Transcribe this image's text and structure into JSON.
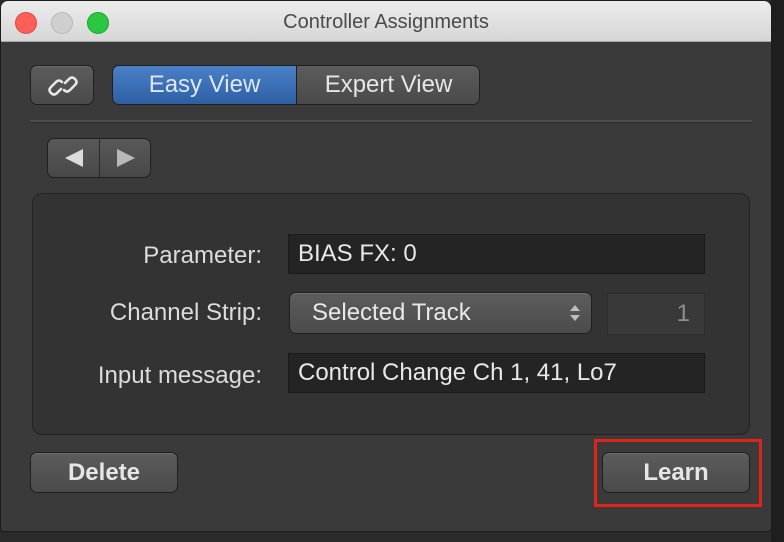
{
  "window": {
    "title": "Controller Assignments"
  },
  "toolbar": {
    "link_icon": "link-icon",
    "view_tabs": [
      {
        "label": "Easy View",
        "selected": true
      },
      {
        "label": "Expert View",
        "selected": false
      }
    ],
    "nav": {
      "prev_icon": "triangle-left-icon",
      "next_icon": "triangle-right-icon"
    }
  },
  "form": {
    "parameter": {
      "label": "Parameter:",
      "value": "BIAS FX: 0"
    },
    "channel_strip": {
      "label": "Channel Strip:",
      "value": "Selected Track",
      "number": "1"
    },
    "input_message": {
      "label": "Input message:",
      "value": "Control Change Ch 1, 41, Lo7"
    }
  },
  "buttons": {
    "delete": "Delete",
    "learn": "Learn"
  },
  "colors": {
    "accent": "#3b6fb8",
    "highlight": "#e0241b",
    "background": "#3a3a3a"
  }
}
